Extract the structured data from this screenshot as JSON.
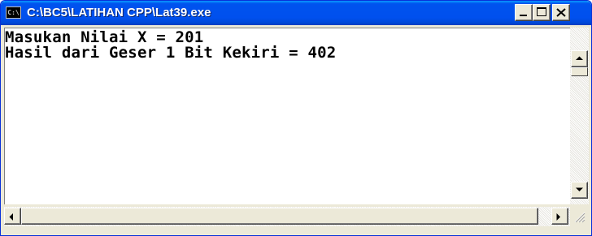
{
  "window": {
    "title": "C:\\BC5\\LATIHAN CPP\\Lat39.exe",
    "app_icon_text": "C:\\"
  },
  "titlebar_buttons": [
    "minimize",
    "maximize",
    "close"
  ],
  "console": {
    "lines": [
      "Masukan Nilai X = 201",
      "Hasil dari Geser 1 Bit Kekiri = 402"
    ]
  },
  "colors": {
    "titlebar": "#0050ee",
    "console_background": "#ffffff",
    "console_text": "#000000",
    "frame": "#ece9d8"
  },
  "icons": {
    "app": "console-app-icon",
    "minimize": "minimize-icon",
    "maximize": "maximize-icon",
    "close": "close-icon",
    "scroll_up": "arrow-up-icon",
    "scroll_down": "arrow-down-icon",
    "scroll_left": "arrow-left-icon",
    "scroll_right": "arrow-right-icon",
    "resize": "resize-grip-icon"
  }
}
